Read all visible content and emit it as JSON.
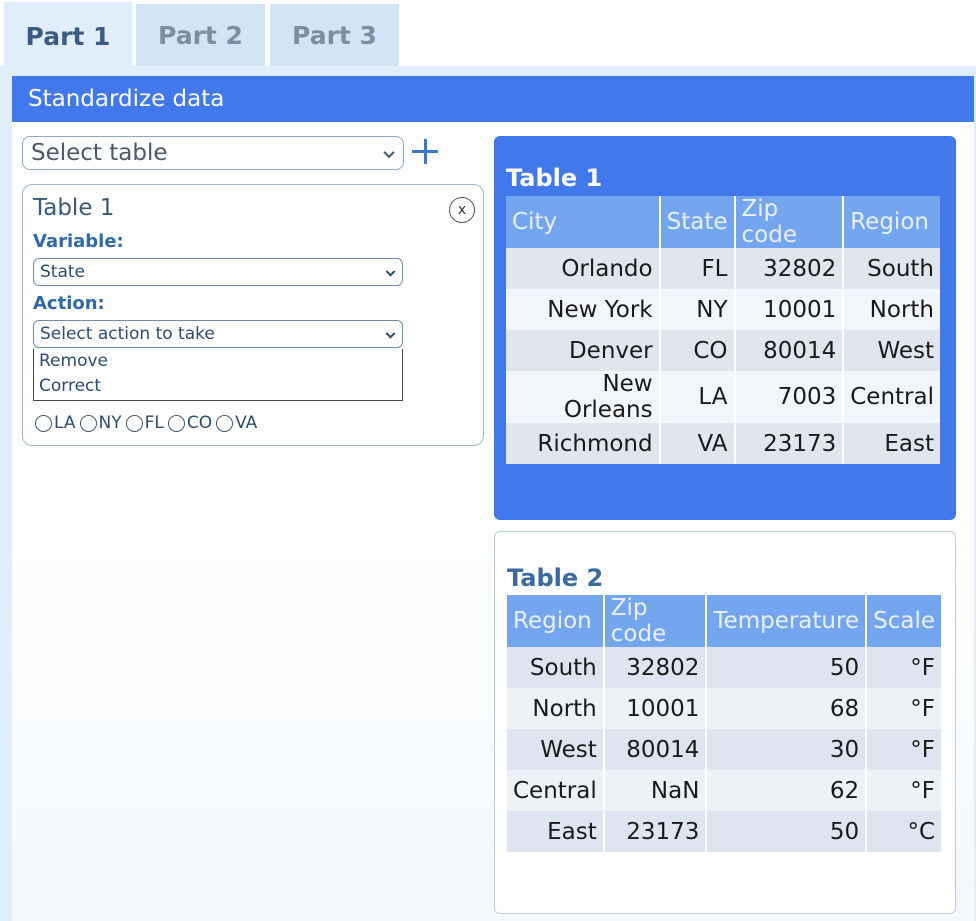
{
  "tabs": [
    {
      "label": "Part 1",
      "active": true
    },
    {
      "label": "Part 2",
      "active": false
    },
    {
      "label": "Part 3",
      "active": false
    }
  ],
  "header": {
    "title": "Standardize data"
  },
  "left_panel": {
    "select_table_value": "Select table",
    "card": {
      "title": "Table 1",
      "close_symbol": "x",
      "variable_label": "Variable:",
      "variable_value": "State",
      "action_label": "Action:",
      "action_value": "Select action to take",
      "action_options": [
        "Remove",
        "Correct"
      ],
      "state_options": [
        "LA",
        "NY",
        "FL",
        "CO",
        "VA"
      ]
    }
  },
  "table1": {
    "title": "Table 1",
    "columns": [
      "City",
      "State",
      "Zip code",
      "Region"
    ],
    "rows": [
      [
        "Orlando",
        "FL",
        "32802",
        "South"
      ],
      [
        "New York",
        "NY",
        "10001",
        "North"
      ],
      [
        "Denver",
        "CO",
        "80014",
        "West"
      ],
      [
        "New Orleans",
        "LA",
        "7003",
        "Central"
      ],
      [
        "Richmond",
        "VA",
        "23173",
        "East"
      ]
    ]
  },
  "table2": {
    "title": "Table 2",
    "columns": [
      "Region",
      "Zip code",
      "Temperature",
      "Scale"
    ],
    "rows": [
      [
        "South",
        "32802",
        "50",
        "°F"
      ],
      [
        "North",
        "10001",
        "68",
        "°F"
      ],
      [
        "West",
        "80014",
        "30",
        "°F"
      ],
      [
        "Central",
        "NaN",
        "62",
        "°F"
      ],
      [
        "East",
        "23173",
        "50",
        "°C"
      ]
    ]
  },
  "colors": {
    "accent": "#4179ec",
    "header_cell": "#74a6f0",
    "frame": "#dfeefa"
  }
}
